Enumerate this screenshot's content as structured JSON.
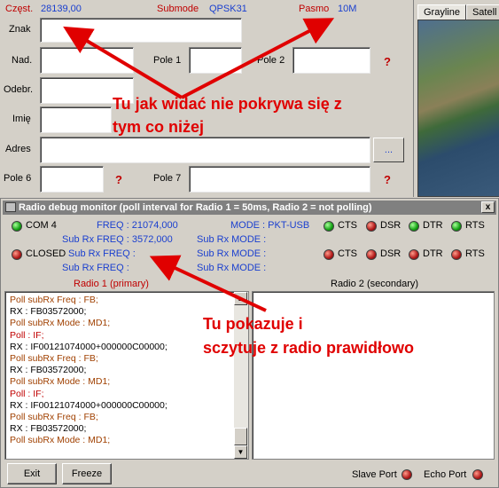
{
  "form": {
    "freq_label": "Częst.",
    "freq_value": "28139,00",
    "submode_label": "Submode",
    "submode_value": "QPSK31",
    "band_label": "Pasmo",
    "band_value": "10M",
    "call_label": "Znak",
    "sent_label": "Nad.",
    "field1_label": "Pole 1",
    "field2_label": "Pole 2",
    "rcvd_label": "Odebr.",
    "name_label": "Imię",
    "address_label": "Adres",
    "address_button": "...",
    "field6_label": "Pole 6",
    "field7_label": "Pole 7",
    "question": "?"
  },
  "map_panel": {
    "tabs": [
      "Grayline",
      "Satell"
    ]
  },
  "debug": {
    "title": "Radio debug monitor (poll interval for Radio 1 = 50ms, Radio 2 = not polling)",
    "close_label": "x",
    "row1": {
      "port": "COM 4",
      "freq": "FREQ : 21074,000",
      "mode": "MODE : PKT-USB",
      "sub_freq": "Sub Rx FREQ : 3572,000",
      "sub_mode": "Sub Rx MODE :"
    },
    "row2": {
      "port": "CLOSED",
      "freq": "Sub Rx FREQ :",
      "mode": "Sub Rx MODE :",
      "sub_freq": "Sub Rx FREQ :",
      "sub_mode": "Sub Rx MODE :"
    },
    "signals": [
      "CTS",
      "DSR",
      "DTR",
      "RTS"
    ],
    "radio1_label": "Radio 1 (primary)",
    "radio2_label": "Radio 2 (secondary)",
    "log": [
      {
        "text": "Poll subRx Freq : FB;",
        "color": "brown"
      },
      {
        "text": "RX : FB03572000;",
        "color": "black"
      },
      {
        "text": "Poll subRx Mode : MD1;",
        "color": "brown"
      },
      {
        "text": "Poll : IF;",
        "color": "red"
      },
      {
        "text": "RX : IF00121074000+000000C00000;",
        "color": "black"
      },
      {
        "text": "Poll subRx Freq : FB;",
        "color": "brown"
      },
      {
        "text": "RX : FB03572000;",
        "color": "black"
      },
      {
        "text": "Poll subRx Mode : MD1;",
        "color": "brown"
      },
      {
        "text": "Poll : IF;",
        "color": "red"
      },
      {
        "text": "RX : IF00121074000+000000C00000;",
        "color": "black"
      },
      {
        "text": "Poll subRx Freq : FB;",
        "color": "brown"
      },
      {
        "text": "RX : FB03572000;",
        "color": "black"
      },
      {
        "text": "Poll subRx Mode : MD1;",
        "color": "brown"
      }
    ],
    "exit_label": "Exit",
    "freeze_label": "Freeze",
    "slave_port_label": "Slave Port",
    "echo_port_label": "Echo Port"
  },
  "annotations": {
    "top_line1": "Tu jak widać nie pokrywa się z",
    "top_line2": "tym co niżej",
    "bottom_line1": "Tu pokazuje i",
    "bottom_line2": "sczytuje z radio prawidłowo"
  },
  "colors": {
    "annotation": "#e00000",
    "value_blue": "#1a3fcf",
    "label_red": "#c00000"
  }
}
